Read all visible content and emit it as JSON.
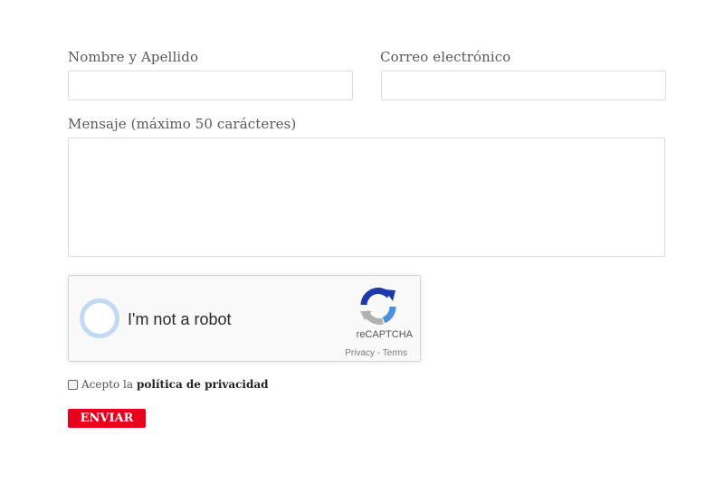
{
  "form": {
    "name_label": "Nombre y Apellido",
    "name_value": "",
    "email_label": "Correo electrónico",
    "email_value": "",
    "message_label": "Mensaje (máximo 50 carácteres)",
    "message_value": ""
  },
  "captcha": {
    "label": "I'm not a robot",
    "brand": "reCAPTCHA",
    "privacy_link": "Privacy",
    "separator": " - ",
    "terms_link": "Terms",
    "icon": "recaptcha-logo-icon",
    "colors": {
      "blue": "#1c3aa9",
      "light_blue": "#4a90e2",
      "grey": "#b1b1b1",
      "checkbox_ring": "#c1d9f2"
    }
  },
  "privacy": {
    "prefix": "Acepto la",
    "link": "política de privacidad",
    "checked": false
  },
  "submit": {
    "label": "ENVIAR",
    "color": "#e8001c"
  }
}
